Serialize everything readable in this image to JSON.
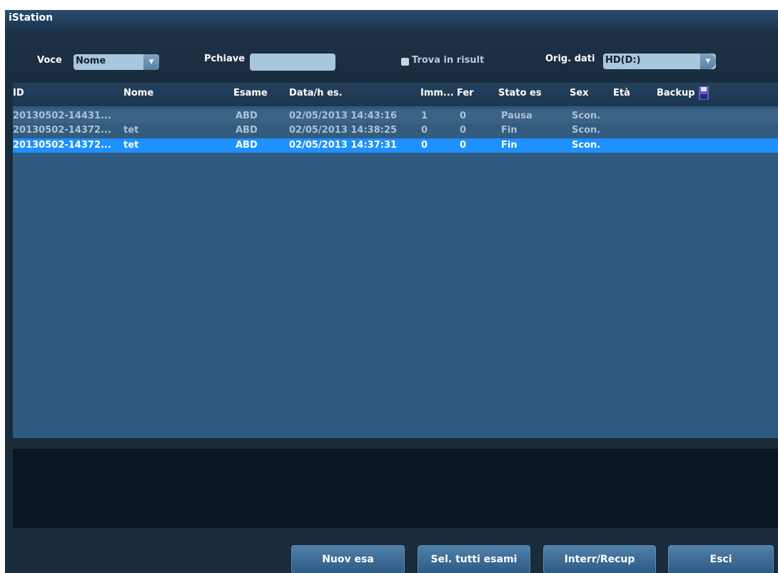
{
  "window": {
    "title": "iStation"
  },
  "toolbar": {
    "voce_label": "Voce",
    "voce_value": "Nome",
    "pchiave_label": "Pchiave",
    "pchiave_value": "",
    "trova_label": "Trova in risult",
    "orig_label": "Orig. dati",
    "orig_value": "HD(D:)"
  },
  "table": {
    "headers": {
      "id": "ID",
      "nome": "Nome",
      "esame": "Esame",
      "data": "Data/h es.",
      "imm": "Imm...",
      "fer": "Fer",
      "stato": "Stato es",
      "sex": "Sex",
      "eta": "Età",
      "backup": "Backup"
    },
    "rows": [
      {
        "id": "20130502-14431...",
        "nome": "",
        "esame": "ABD",
        "data": "02/05/2013 14:43:16",
        "imm": "1",
        "fer": "0",
        "stato": "Pausa",
        "sex": "Scon.",
        "eta": ""
      },
      {
        "id": "20130502-14372...",
        "nome": "tet",
        "esame": "ABD",
        "data": "02/05/2013 14:38:25",
        "imm": "0",
        "fer": "0",
        "stato": "Fin",
        "sex": "Scon.",
        "eta": ""
      },
      {
        "id": "20130502-14372...",
        "nome": "tet",
        "esame": "ABD",
        "data": "02/05/2013 14:37:31",
        "imm": "0",
        "fer": "0",
        "stato": "Fin",
        "sex": "Scon.",
        "eta": ""
      }
    ],
    "selected_row": 2
  },
  "buttons": {
    "nuovo": "Nuov esa",
    "sel_tutti": "Sel. tutti esami",
    "interr": "Interr/Recup",
    "esci": "Esci"
  },
  "colors": {
    "selected_row": "#1e90ff",
    "table_bg": "#2f5a80",
    "window_bg": "#1a2b3c"
  },
  "icons": {
    "backup": "floppy-disk-icon",
    "combo_arrow": "chevron-down-icon"
  }
}
